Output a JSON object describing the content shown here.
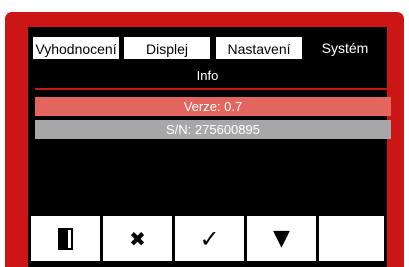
{
  "tabs": [
    {
      "label": "Vyhodnocení",
      "active": false
    },
    {
      "label": "Displej",
      "active": false
    },
    {
      "label": "Nastavení",
      "active": false
    },
    {
      "label": "Systém",
      "active": true
    }
  ],
  "section": {
    "title": "Info"
  },
  "info_rows": [
    {
      "text": "Verze: 0.7",
      "color": "#e2665d"
    },
    {
      "text": "S/N: 275600895",
      "color": "#a7a7a7"
    }
  ],
  "softkeys": [
    {
      "icon": "door-exit-icon",
      "glyph": "exit"
    },
    {
      "icon": "cross-icon",
      "glyph": "✖"
    },
    {
      "icon": "checkmark-icon",
      "glyph": "✓"
    },
    {
      "icon": "triangle-down-icon",
      "glyph": "▼"
    },
    {
      "icon": "",
      "glyph": ""
    }
  ],
  "colors": {
    "frame": "#cc1515",
    "screen": "#000000",
    "accent_rule": "#cc1515"
  }
}
